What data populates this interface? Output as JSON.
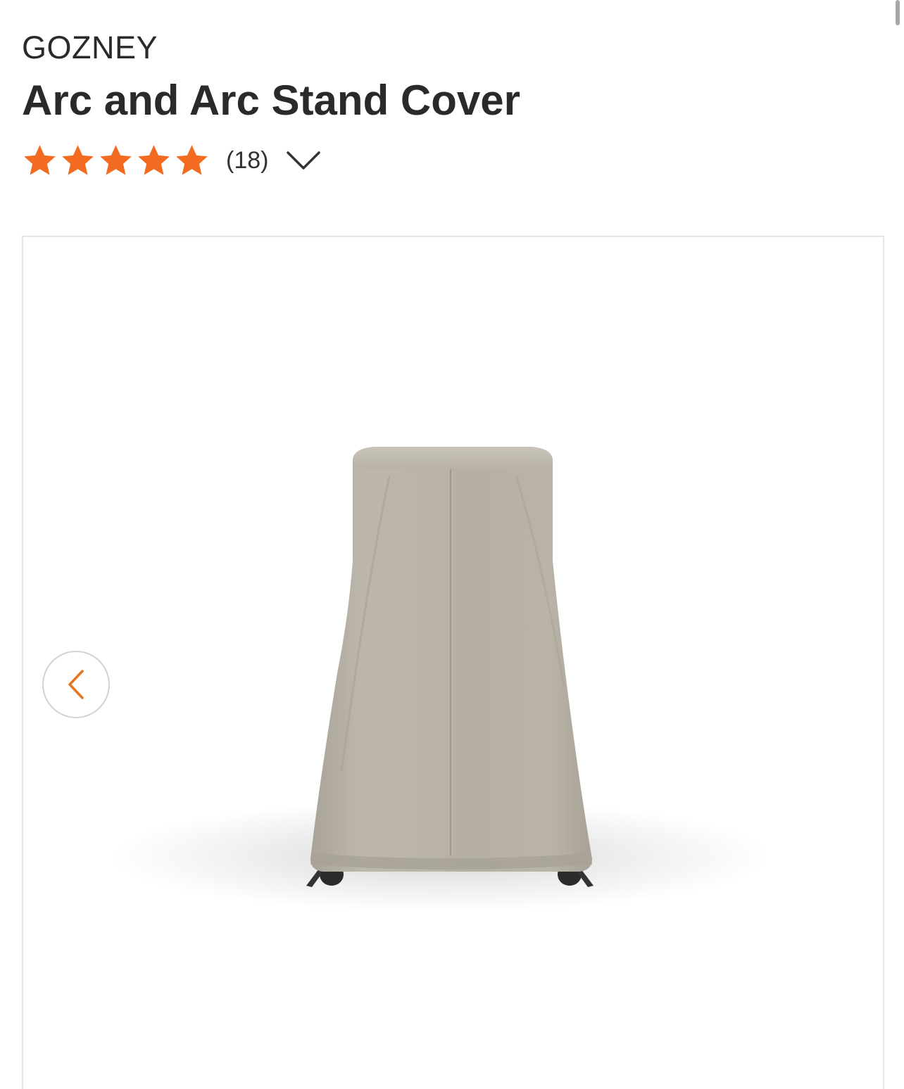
{
  "product": {
    "brand": "GOZNEY",
    "title": "Arc and Arc Stand Cover",
    "rating": {
      "value": 5,
      "max": 5,
      "review_count": "(18)",
      "star_color": "#f26b21"
    }
  },
  "gallery": {
    "image_icon": "pizza-oven-cover-image",
    "prev_icon": "chevron-left-icon",
    "prev_icon_color": "#e5761f",
    "cover_color": "#b8b2a6"
  }
}
